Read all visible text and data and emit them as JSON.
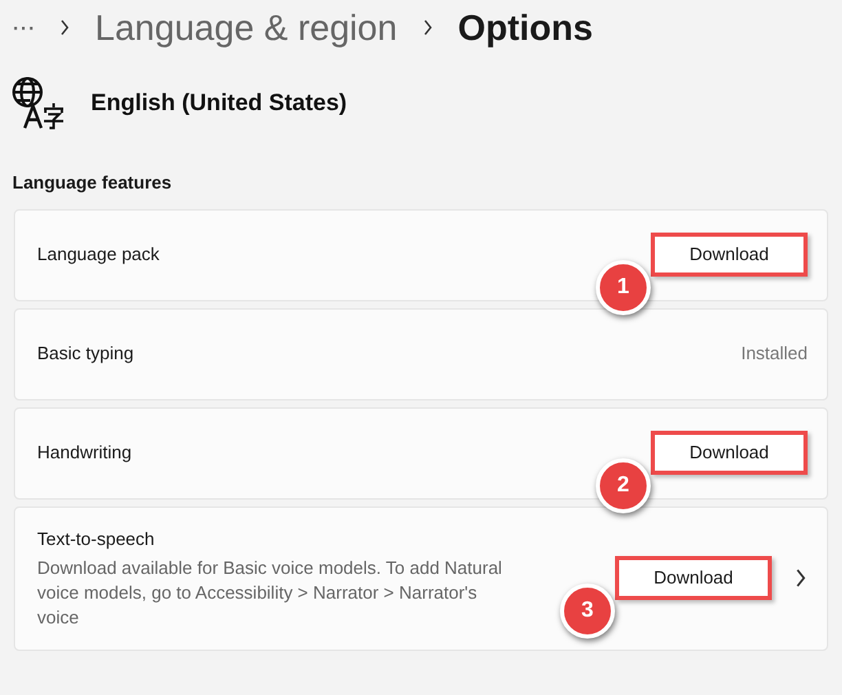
{
  "breadcrumb": {
    "more": "···",
    "items": [
      {
        "label": "Language & region",
        "selected": false
      },
      {
        "label": "Options",
        "selected": true
      }
    ]
  },
  "language": {
    "name": "English (United States)"
  },
  "section": {
    "title": "Language features"
  },
  "features": [
    {
      "kind": "download",
      "title": "Language pack",
      "action": "Download",
      "callout": "1",
      "chevron": false
    },
    {
      "kind": "installed",
      "title": "Basic typing",
      "status": "Installed"
    },
    {
      "kind": "download",
      "title": "Handwriting",
      "action": "Download",
      "callout": "2",
      "chevron": false
    },
    {
      "kind": "download",
      "title": "Text-to-speech",
      "description": "Download available for Basic voice models. To add Natural voice models, go to Accessibility > Narrator > Narrator's voice",
      "action": "Download",
      "callout": "3",
      "chevron": true
    }
  ]
}
